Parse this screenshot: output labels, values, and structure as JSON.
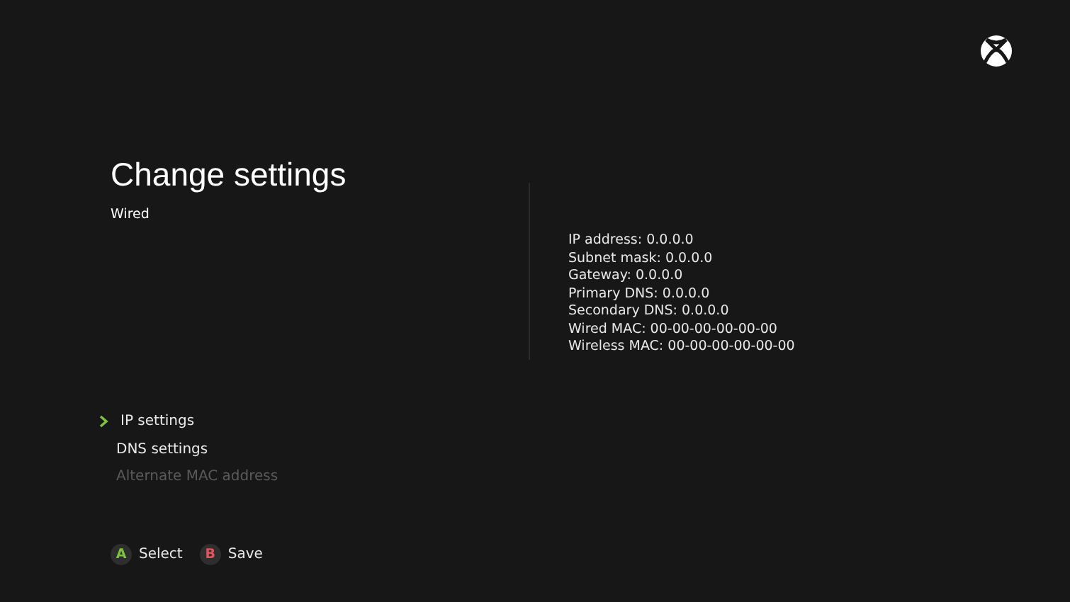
{
  "title": "Change settings",
  "subtitle": "Wired",
  "menu": [
    {
      "label": "IP settings",
      "selected": true,
      "disabled": false
    },
    {
      "label": "DNS settings",
      "selected": false,
      "disabled": false
    },
    {
      "label": "Alternate MAC address",
      "selected": false,
      "disabled": true
    }
  ],
  "info": [
    "IP address: 0.0.0.0",
    "Subnet mask: 0.0.0.0",
    "Gateway: 0.0.0.0",
    "Primary DNS: 0.0.0.0",
    "Secondary DNS: 0.0.0.0",
    "Wired MAC: 00-00-00-00-00-00",
    "Wireless MAC: 00-00-00-00-00-00"
  ],
  "hints": [
    {
      "key": "A",
      "label": "Select",
      "color": "#7fc241"
    },
    {
      "key": "B",
      "label": "Save",
      "color": "#e0545c"
    }
  ]
}
